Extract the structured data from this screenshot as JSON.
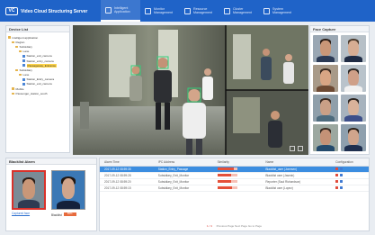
{
  "header": {
    "brand": "Video Cloud Structuring Server",
    "logo_text": "VC",
    "nav": [
      {
        "label": "Intelligent Application",
        "active": true
      },
      {
        "label": "Monitor Management",
        "active": false
      },
      {
        "label": "Resource Management",
        "active": false
      },
      {
        "label": "Cluster Management",
        "active": false
      },
      {
        "label": "System Management",
        "active": false
      }
    ]
  },
  "tree": {
    "title": "Device List",
    "nodes": [
      {
        "label": "intelligent application",
        "level": 0,
        "kind": "folder"
      },
      {
        "label": "Region",
        "level": 1,
        "kind": "folder"
      },
      {
        "label": "Subsidiary",
        "level": 2,
        "kind": "folder"
      },
      {
        "label": "Lane",
        "level": 3,
        "kind": "folder"
      },
      {
        "label": "Station_exit_camera",
        "level": 4,
        "kind": "cam"
      },
      {
        "label": "Station_entry_camera",
        "level": 4,
        "kind": "cam"
      },
      {
        "label": "Passageway_Entrance",
        "level": 4,
        "kind": "cam",
        "selected": true
      },
      {
        "label": "Subsidiary",
        "level": 2,
        "kind": "folder"
      },
      {
        "label": "Lane",
        "level": 3,
        "kind": "folder"
      },
      {
        "label": "Station_Entry_camera",
        "level": 4,
        "kind": "cam"
      },
      {
        "label": "Station_exit_camera",
        "level": 4,
        "kind": "cam"
      },
      {
        "label": "Mobile",
        "level": 1,
        "kind": "folder"
      },
      {
        "label": "Passenger_station_south",
        "level": 1,
        "kind": "folder"
      }
    ]
  },
  "faces": {
    "title": "Face Capture",
    "items": [
      {
        "skin": "#c99778",
        "hair": "#2a1d16",
        "body": "#2b3a55",
        "bg": "#9aa7b3"
      },
      {
        "skin": "#d7ad93",
        "hair": "#4a3a2c",
        "body": "#1f2b44",
        "bg": "#b7c0c7"
      },
      {
        "skin": "#d8a584",
        "hair": "#3b2a20",
        "body": "#6d4a33",
        "bg": "#a89a88"
      },
      {
        "skin": "#cfa088",
        "hair": "#2b2623",
        "body": "#f1f1f1",
        "bg": "#b9c3cb"
      },
      {
        "skin": "#caa086",
        "hair": "#3d2c22",
        "body": "#4d6b7d",
        "bg": "#8f9faa"
      },
      {
        "skin": "#d9b29a",
        "hair": "#2e2520",
        "body": "#3d4f8a",
        "bg": "#a7b3be"
      },
      {
        "skin": "#c49277",
        "hair": "#382a22",
        "body": "#234a6c",
        "bg": "#9ca8a0"
      },
      {
        "skin": "#d0a58c",
        "hair": "#2c2119",
        "body": "#1e2f4f",
        "bg": "#8ea0ae"
      }
    ]
  },
  "blacklist": {
    "title": "Blacklist Alarm",
    "captured_label": "Captured face",
    "library_label": "Blacklist",
    "similarity_value": "85%"
  },
  "alarm_table": {
    "columns": [
      "Alarm Time",
      "IPC Address",
      "Similarity",
      "Name",
      "Configuration"
    ],
    "rows": [
      {
        "time": "2017-09-12 08:59:35",
        "ipc": "Station_Entry_Passage",
        "similarity": 0.85,
        "name": "Blacklist_user (Jonesen)",
        "selected": true
      },
      {
        "time": "2017-09-12 08:59:28",
        "ipc": "Subsidiary_Exit_Monitor",
        "similarity": 0.72,
        "name": "Blacklist user (Jasmin)",
        "selected": false
      },
      {
        "time": "2017-09-12 08:59:20",
        "ipc": "Subsidiary_Exit_Monitor",
        "similarity": 0.68,
        "name": "Reporter (Saul Richardson)",
        "selected": false
      },
      {
        "time": "2017-09-12 08:59:15",
        "ipc": "Subsidiary_Exit_Monitor",
        "similarity": 0.75,
        "name": "Blacklist user (Lopez)",
        "selected": false
      }
    ],
    "pager_current": "1 / 4",
    "pager_text": "Previous Page  Next Page  Go to  Page"
  },
  "video": {
    "camera": "Passageway_Entrance"
  }
}
